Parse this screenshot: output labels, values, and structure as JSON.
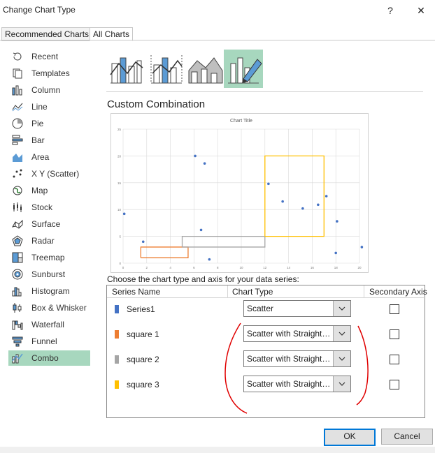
{
  "window": {
    "title": "Change Chart Type",
    "help_glyph": "?",
    "close_glyph": "✕"
  },
  "tabs": [
    {
      "label": "Recommended Charts"
    },
    {
      "label": "All Charts"
    }
  ],
  "sidebar": {
    "items": [
      {
        "label": "Recent",
        "icon": "recent-icon"
      },
      {
        "label": "Templates",
        "icon": "templates-icon"
      },
      {
        "label": "Column",
        "icon": "column-chart-icon"
      },
      {
        "label": "Line",
        "icon": "line-chart-icon"
      },
      {
        "label": "Pie",
        "icon": "pie-chart-icon"
      },
      {
        "label": "Bar",
        "icon": "bar-chart-icon"
      },
      {
        "label": "Area",
        "icon": "area-chart-icon"
      },
      {
        "label": "X Y (Scatter)",
        "icon": "scatter-chart-icon"
      },
      {
        "label": "Map",
        "icon": "map-chart-icon"
      },
      {
        "label": "Stock",
        "icon": "stock-chart-icon"
      },
      {
        "label": "Surface",
        "icon": "surface-chart-icon"
      },
      {
        "label": "Radar",
        "icon": "radar-chart-icon"
      },
      {
        "label": "Treemap",
        "icon": "treemap-chart-icon"
      },
      {
        "label": "Sunburst",
        "icon": "sunburst-chart-icon"
      },
      {
        "label": "Histogram",
        "icon": "histogram-chart-icon"
      },
      {
        "label": "Box & Whisker",
        "icon": "box-whisker-chart-icon"
      },
      {
        "label": "Waterfall",
        "icon": "waterfall-chart-icon"
      },
      {
        "label": "Funnel",
        "icon": "funnel-chart-icon"
      },
      {
        "label": "Combo",
        "icon": "combo-chart-icon",
        "selected": true
      }
    ]
  },
  "main": {
    "section_title": "Custom Combination",
    "series_caption": "Choose the chart type and axis for your data series:",
    "columns": {
      "series_name": "Series Name",
      "chart_type": "Chart Type",
      "secondary_axis": "Secondary Axis"
    },
    "series_rows": [
      {
        "name": "Series1",
        "color": "#4472c4",
        "chart_type": "Scatter",
        "secondary": false
      },
      {
        "name": "square 1",
        "color": "#ed7d31",
        "chart_type": "Scatter with Straight Lines",
        "secondary": false
      },
      {
        "name": "square 2",
        "color": "#a5a5a5",
        "chart_type": "Scatter with Straight Lines",
        "secondary": false
      },
      {
        "name": "square 3",
        "color": "#ffc000",
        "chart_type": "Scatter with Straight Lines",
        "secondary": false
      }
    ],
    "annotation_color": "#e00000"
  },
  "chart_data": {
    "type": "scatter",
    "title": "Chart Title",
    "xlim": [
      0,
      20
    ],
    "ylim": [
      0,
      25
    ],
    "x_ticks": [
      "0",
      "2",
      "4",
      "6",
      "8",
      "10",
      "12",
      "14",
      "16",
      "18",
      "20"
    ],
    "y_ticks": [
      "0",
      "5",
      "10",
      "15",
      "20",
      "25"
    ],
    "grid": true,
    "series": [
      {
        "name": "Series1",
        "kind": "points",
        "color": "#4472c4",
        "x": [
          0.1,
          1.7,
          6.1,
          6.9,
          6.6,
          7.3,
          12.3,
          13.5,
          15.2,
          18.0,
          18.1,
          20.2,
          23.1,
          17.2,
          16.5
        ],
        "y": [
          9.2,
          4.0,
          20.0,
          18.6,
          6.2,
          0.7,
          14.8,
          11.5,
          10.2,
          1.9,
          7.8,
          3.0,
          14.7,
          12.5,
          10.9
        ]
      },
      {
        "name": "square 1",
        "kind": "line",
        "color": "#ed7d31",
        "x": [
          1.5,
          5.5,
          5.5,
          1.5,
          1.5
        ],
        "y": [
          1,
          1,
          3,
          3,
          1
        ]
      },
      {
        "name": "square 2",
        "kind": "line",
        "color": "#a5a5a5",
        "x": [
          5,
          12,
          12,
          5,
          5
        ],
        "y": [
          3,
          3,
          5,
          5,
          3
        ]
      },
      {
        "name": "square 3",
        "kind": "line",
        "color": "#ffc000",
        "x": [
          12,
          17,
          17,
          12,
          12
        ],
        "y": [
          5,
          5,
          20,
          20,
          5
        ]
      }
    ]
  }
}
